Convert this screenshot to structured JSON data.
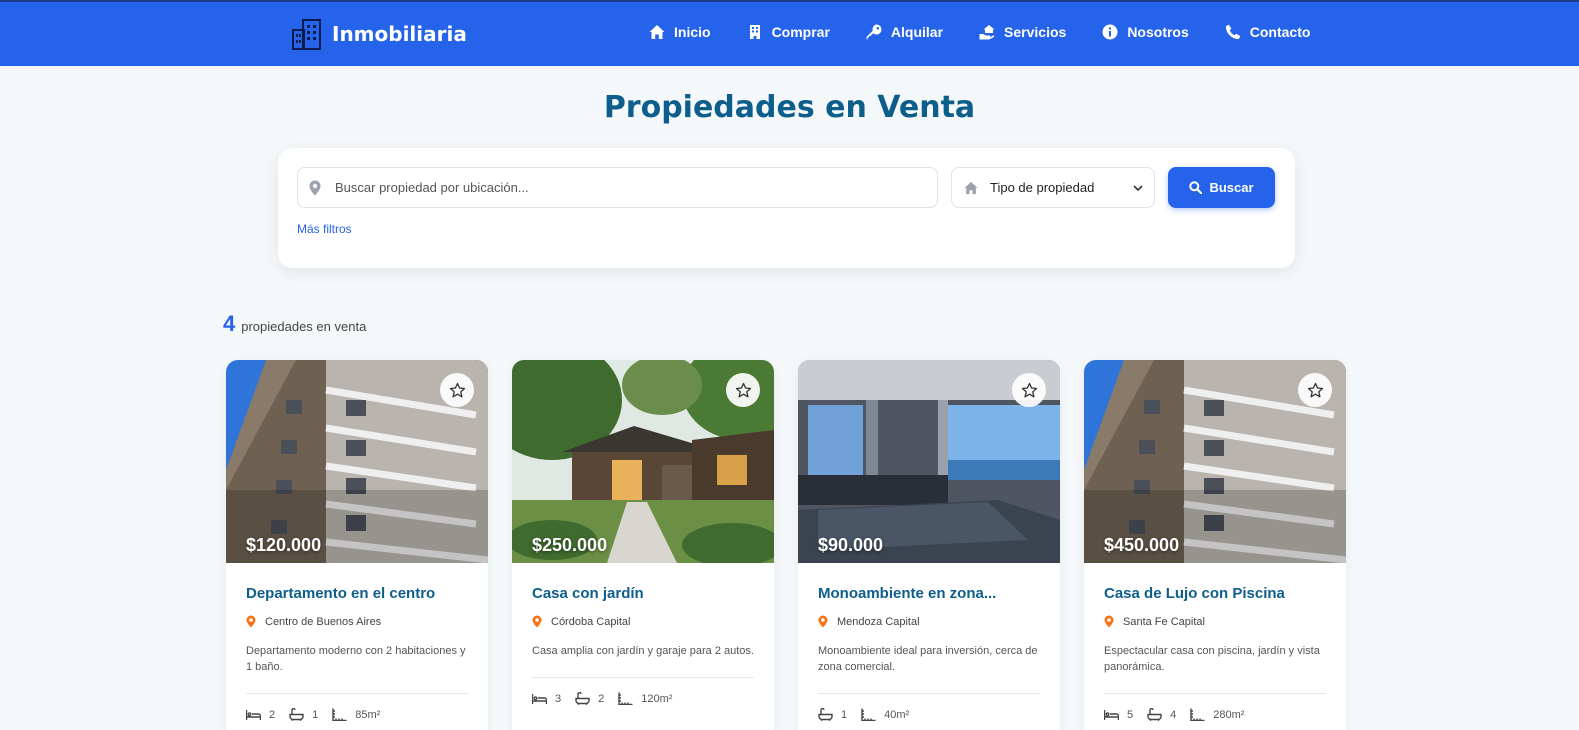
{
  "brand": {
    "name": "Inmobiliaria",
    "icon": "building-icon"
  },
  "nav": [
    {
      "label": "Inicio",
      "icon": "home-icon"
    },
    {
      "label": "Comprar",
      "icon": "building-icon"
    },
    {
      "label": "Alquilar",
      "icon": "key-icon"
    },
    {
      "label": "Servicios",
      "icon": "hand-house-icon"
    },
    {
      "label": "Nosotros",
      "icon": "info-icon"
    },
    {
      "label": "Contacto",
      "icon": "phone-icon"
    }
  ],
  "page_title": "Propiedades en Venta",
  "search": {
    "placeholder": "Buscar propiedad por ubicación...",
    "type_label": "Tipo de propiedad",
    "button_label": "Buscar",
    "more_filters": "Más filtros"
  },
  "results": {
    "count": "4",
    "label": "propiedades en venta"
  },
  "colors": {
    "primary": "#2563eb",
    "title": "#0e5e8c",
    "pin": "#f97316",
    "background": "#f5f8fa"
  },
  "properties": [
    {
      "price": "$120.000",
      "title": "Departamento en el centro",
      "location": "Centro de Buenos Aires",
      "description": "Departamento moderno con 2 habitaciones y 1 baño.",
      "beds": "2",
      "baths": "1",
      "area": "85m²"
    },
    {
      "price": "$250.000",
      "title": "Casa con jardín",
      "location": "Córdoba Capital",
      "description": "Casa amplia con jardín y garaje para 2 autos.",
      "beds": "3",
      "baths": "2",
      "area": "120m²"
    },
    {
      "price": "$90.000",
      "title": "Monoambiente en zona...",
      "location": "Mendoza Capital",
      "description": "Monoambiente ideal para inversión, cerca de zona comercial.",
      "baths": "1",
      "area": "40m²"
    },
    {
      "price": "$450.000",
      "title": "Casa de Lujo con Piscina",
      "location": "Santa Fe Capital",
      "description": "Espectacular casa con piscina, jardín y vista panorámica.",
      "beds": "5",
      "baths": "4",
      "area": "280m²"
    }
  ]
}
